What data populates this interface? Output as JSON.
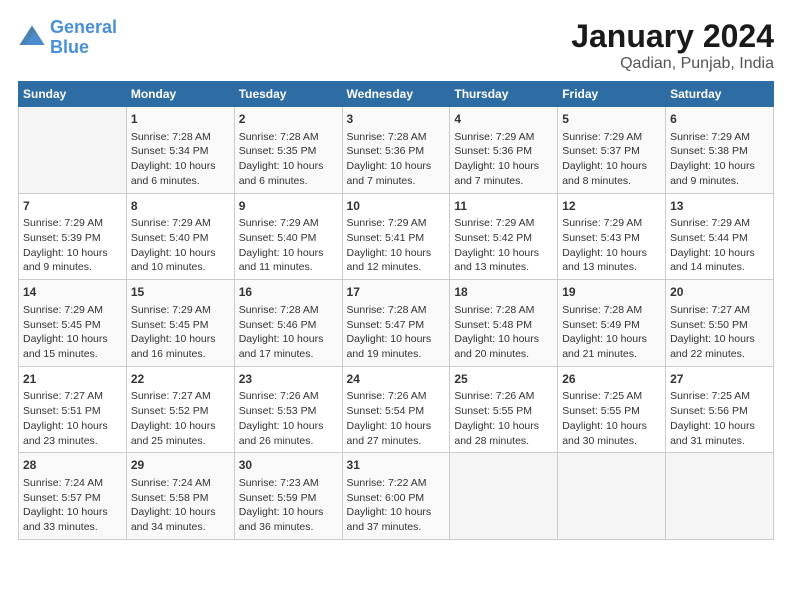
{
  "logo": {
    "line1": "General",
    "line2": "Blue"
  },
  "title": "January 2024",
  "subtitle": "Qadian, Punjab, India",
  "days_of_week": [
    "Sunday",
    "Monday",
    "Tuesday",
    "Wednesday",
    "Thursday",
    "Friday",
    "Saturday"
  ],
  "weeks": [
    [
      {
        "day": "",
        "content": ""
      },
      {
        "day": "1",
        "content": "Sunrise: 7:28 AM\nSunset: 5:34 PM\nDaylight: 10 hours\nand 6 minutes."
      },
      {
        "day": "2",
        "content": "Sunrise: 7:28 AM\nSunset: 5:35 PM\nDaylight: 10 hours\nand 6 minutes."
      },
      {
        "day": "3",
        "content": "Sunrise: 7:28 AM\nSunset: 5:36 PM\nDaylight: 10 hours\nand 7 minutes."
      },
      {
        "day": "4",
        "content": "Sunrise: 7:29 AM\nSunset: 5:36 PM\nDaylight: 10 hours\nand 7 minutes."
      },
      {
        "day": "5",
        "content": "Sunrise: 7:29 AM\nSunset: 5:37 PM\nDaylight: 10 hours\nand 8 minutes."
      },
      {
        "day": "6",
        "content": "Sunrise: 7:29 AM\nSunset: 5:38 PM\nDaylight: 10 hours\nand 9 minutes."
      }
    ],
    [
      {
        "day": "7",
        "content": "Sunrise: 7:29 AM\nSunset: 5:39 PM\nDaylight: 10 hours\nand 9 minutes."
      },
      {
        "day": "8",
        "content": "Sunrise: 7:29 AM\nSunset: 5:40 PM\nDaylight: 10 hours\nand 10 minutes."
      },
      {
        "day": "9",
        "content": "Sunrise: 7:29 AM\nSunset: 5:40 PM\nDaylight: 10 hours\nand 11 minutes."
      },
      {
        "day": "10",
        "content": "Sunrise: 7:29 AM\nSunset: 5:41 PM\nDaylight: 10 hours\nand 12 minutes."
      },
      {
        "day": "11",
        "content": "Sunrise: 7:29 AM\nSunset: 5:42 PM\nDaylight: 10 hours\nand 13 minutes."
      },
      {
        "day": "12",
        "content": "Sunrise: 7:29 AM\nSunset: 5:43 PM\nDaylight: 10 hours\nand 13 minutes."
      },
      {
        "day": "13",
        "content": "Sunrise: 7:29 AM\nSunset: 5:44 PM\nDaylight: 10 hours\nand 14 minutes."
      }
    ],
    [
      {
        "day": "14",
        "content": "Sunrise: 7:29 AM\nSunset: 5:45 PM\nDaylight: 10 hours\nand 15 minutes."
      },
      {
        "day": "15",
        "content": "Sunrise: 7:29 AM\nSunset: 5:45 PM\nDaylight: 10 hours\nand 16 minutes."
      },
      {
        "day": "16",
        "content": "Sunrise: 7:28 AM\nSunset: 5:46 PM\nDaylight: 10 hours\nand 17 minutes."
      },
      {
        "day": "17",
        "content": "Sunrise: 7:28 AM\nSunset: 5:47 PM\nDaylight: 10 hours\nand 19 minutes."
      },
      {
        "day": "18",
        "content": "Sunrise: 7:28 AM\nSunset: 5:48 PM\nDaylight: 10 hours\nand 20 minutes."
      },
      {
        "day": "19",
        "content": "Sunrise: 7:28 AM\nSunset: 5:49 PM\nDaylight: 10 hours\nand 21 minutes."
      },
      {
        "day": "20",
        "content": "Sunrise: 7:27 AM\nSunset: 5:50 PM\nDaylight: 10 hours\nand 22 minutes."
      }
    ],
    [
      {
        "day": "21",
        "content": "Sunrise: 7:27 AM\nSunset: 5:51 PM\nDaylight: 10 hours\nand 23 minutes."
      },
      {
        "day": "22",
        "content": "Sunrise: 7:27 AM\nSunset: 5:52 PM\nDaylight: 10 hours\nand 25 minutes."
      },
      {
        "day": "23",
        "content": "Sunrise: 7:26 AM\nSunset: 5:53 PM\nDaylight: 10 hours\nand 26 minutes."
      },
      {
        "day": "24",
        "content": "Sunrise: 7:26 AM\nSunset: 5:54 PM\nDaylight: 10 hours\nand 27 minutes."
      },
      {
        "day": "25",
        "content": "Sunrise: 7:26 AM\nSunset: 5:55 PM\nDaylight: 10 hours\nand 28 minutes."
      },
      {
        "day": "26",
        "content": "Sunrise: 7:25 AM\nSunset: 5:55 PM\nDaylight: 10 hours\nand 30 minutes."
      },
      {
        "day": "27",
        "content": "Sunrise: 7:25 AM\nSunset: 5:56 PM\nDaylight: 10 hours\nand 31 minutes."
      }
    ],
    [
      {
        "day": "28",
        "content": "Sunrise: 7:24 AM\nSunset: 5:57 PM\nDaylight: 10 hours\nand 33 minutes."
      },
      {
        "day": "29",
        "content": "Sunrise: 7:24 AM\nSunset: 5:58 PM\nDaylight: 10 hours\nand 34 minutes."
      },
      {
        "day": "30",
        "content": "Sunrise: 7:23 AM\nSunset: 5:59 PM\nDaylight: 10 hours\nand 36 minutes."
      },
      {
        "day": "31",
        "content": "Sunrise: 7:22 AM\nSunset: 6:00 PM\nDaylight: 10 hours\nand 37 minutes."
      },
      {
        "day": "",
        "content": ""
      },
      {
        "day": "",
        "content": ""
      },
      {
        "day": "",
        "content": ""
      }
    ]
  ]
}
